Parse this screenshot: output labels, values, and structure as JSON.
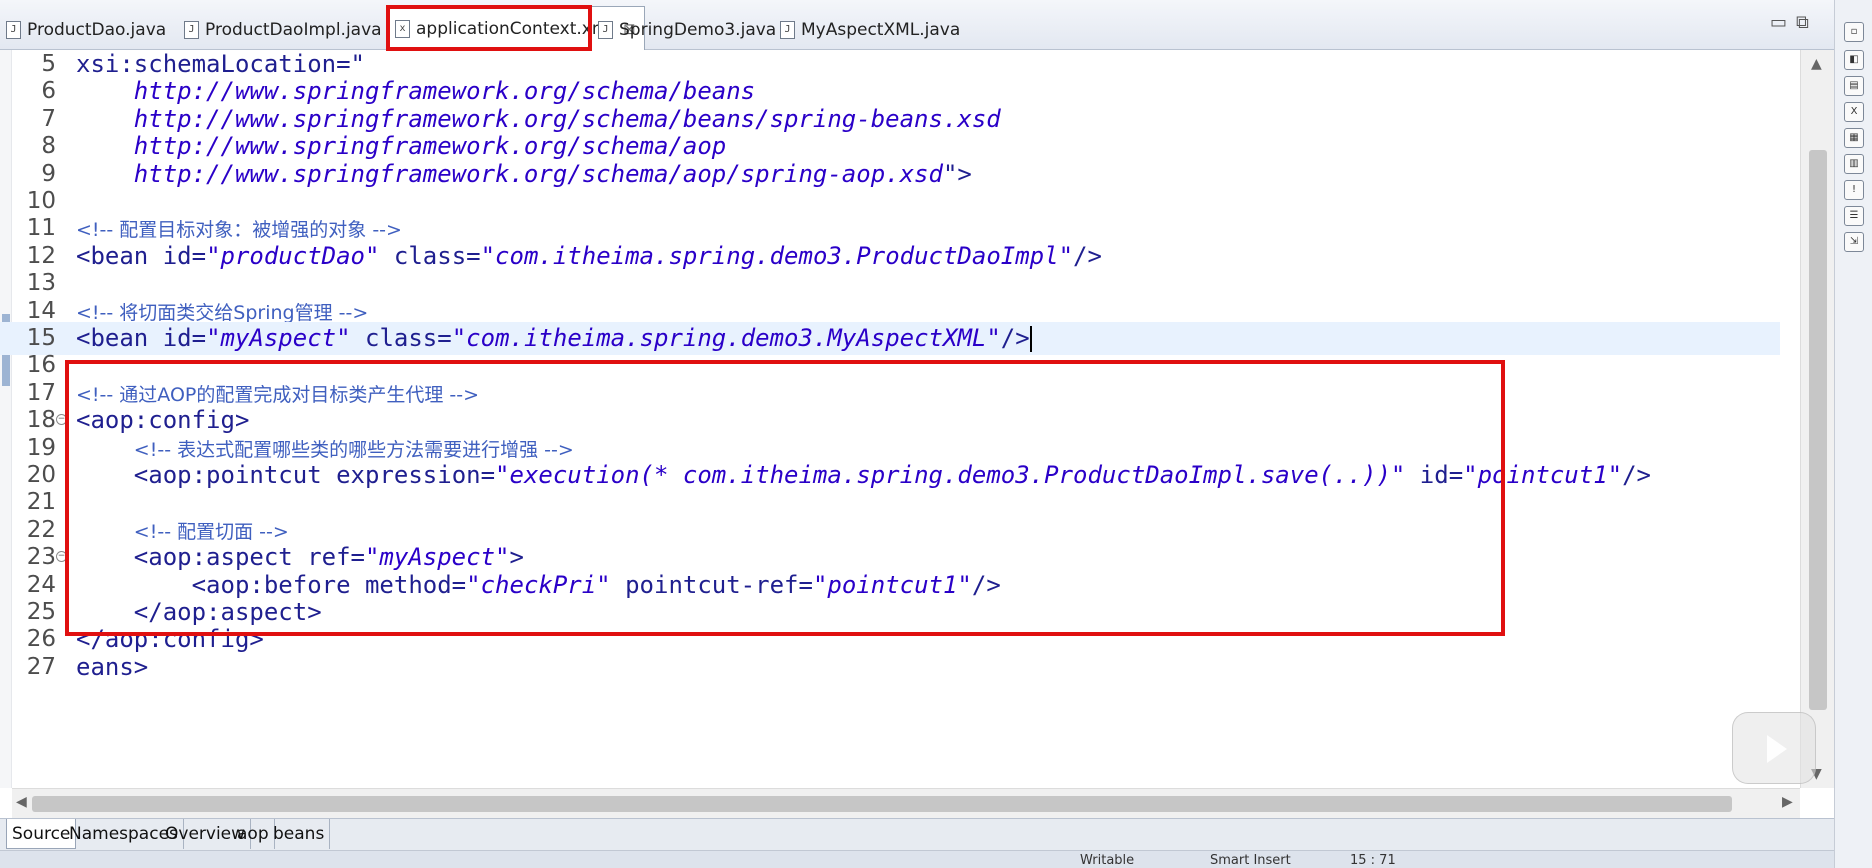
{
  "tabs": [
    {
      "label": "ProductDao.java"
    },
    {
      "label": "ProductDaoImpl.java"
    },
    {
      "label": "applicationContext.xml"
    },
    {
      "label": "SpringDemo3.java"
    },
    {
      "label": "MyAspectXML.java"
    }
  ],
  "editor": {
    "lines": [
      {
        "num": "5",
        "code": [
          {
            "t": "xsi:schemaLocation=\"",
            "c": "attr"
          }
        ]
      },
      {
        "num": "6",
        "code": [
          {
            "t": "    http://www.springframework.org/schema/beans",
            "c": "val"
          }
        ]
      },
      {
        "num": "7",
        "code": [
          {
            "t": "    http://www.springframework.org/schema/beans/spring-beans.xsd",
            "c": "val"
          }
        ]
      },
      {
        "num": "8",
        "code": [
          {
            "t": "    http://www.springframework.org/schema/aop",
            "c": "val"
          }
        ]
      },
      {
        "num": "9",
        "code": [
          {
            "t": "    http://www.springframework.org/schema/aop/spring-aop.xsd",
            "c": "val"
          },
          {
            "t": "\">",
            "c": "tag"
          }
        ]
      },
      {
        "num": "10",
        "code": []
      },
      {
        "num": "11",
        "code": [
          {
            "t": "<!-- 配置目标对象：被增强的对象 -->",
            "c": "cm"
          }
        ]
      },
      {
        "num": "12",
        "code": [
          {
            "t": "<bean ",
            "c": "tag"
          },
          {
            "t": "id=",
            "c": "attr"
          },
          {
            "t": "\"productDao\"",
            "c": "val"
          },
          {
            "t": " class=",
            "c": "attr"
          },
          {
            "t": "\"com.itheima.spring.demo3.ProductDaoImpl\"",
            "c": "val"
          },
          {
            "t": "/>",
            "c": "tag"
          }
        ]
      },
      {
        "num": "13",
        "code": []
      },
      {
        "num": "14",
        "code": [
          {
            "t": "<!-- 将切面类交给Spring管理 -->",
            "c": "cm"
          }
        ]
      },
      {
        "num": "15",
        "code": [
          {
            "t": "<bean ",
            "c": "tag"
          },
          {
            "t": "id=",
            "c": "attr"
          },
          {
            "t": "\"myAspect\"",
            "c": "val"
          },
          {
            "t": " class=",
            "c": "attr"
          },
          {
            "t": "\"com.itheima.spring.demo3.MyAspectXML\"",
            "c": "val"
          },
          {
            "t": "/>",
            "c": "tag"
          }
        ],
        "current": true
      },
      {
        "num": "16",
        "code": []
      },
      {
        "num": "17",
        "code": [
          {
            "t": "<!-- 通过AOP的配置完成对目标类产生代理 -->",
            "c": "cm"
          }
        ]
      },
      {
        "num": "18",
        "code": [
          {
            "t": "<aop:config>",
            "c": "tag"
          }
        ],
        "fold": true
      },
      {
        "num": "19",
        "code": [
          {
            "t": "    ",
            "c": "tag"
          },
          {
            "t": "<!-- 表达式配置哪些类的哪些方法需要进行增强 -->",
            "c": "cm"
          }
        ]
      },
      {
        "num": "20",
        "code": [
          {
            "t": "    <aop:pointcut ",
            "c": "tag"
          },
          {
            "t": "expression=",
            "c": "attr"
          },
          {
            "t": "\"execution(* com.itheima.spring.demo3.ProductDaoImpl.save(..))\"",
            "c": "val"
          },
          {
            "t": " id=",
            "c": "attr"
          },
          {
            "t": "\"pointcut1\"",
            "c": "val"
          },
          {
            "t": "/>",
            "c": "tag"
          }
        ]
      },
      {
        "num": "21",
        "code": []
      },
      {
        "num": "22",
        "code": [
          {
            "t": "    ",
            "c": "tag"
          },
          {
            "t": "<!-- 配置切面 -->",
            "c": "cm"
          }
        ]
      },
      {
        "num": "23",
        "code": [
          {
            "t": "    <aop:aspect ",
            "c": "tag"
          },
          {
            "t": "ref=",
            "c": "attr"
          },
          {
            "t": "\"myAspect\"",
            "c": "val"
          },
          {
            "t": ">",
            "c": "tag"
          }
        ],
        "fold": true
      },
      {
        "num": "24",
        "code": [
          {
            "t": "        <aop:before ",
            "c": "tag"
          },
          {
            "t": "method=",
            "c": "attr"
          },
          {
            "t": "\"checkPri\"",
            "c": "val"
          },
          {
            "t": " pointcut-ref=",
            "c": "attr"
          },
          {
            "t": "\"pointcut1\"",
            "c": "val"
          },
          {
            "t": "/>",
            "c": "tag"
          }
        ]
      },
      {
        "num": "25",
        "code": [
          {
            "t": "    </aop:aspect>",
            "c": "tag"
          }
        ]
      },
      {
        "num": "26",
        "code": [
          {
            "t": "</aop:config>",
            "c": "tag"
          }
        ]
      },
      {
        "num": "27",
        "code": [
          {
            "t": "eans>",
            "c": "tag"
          }
        ]
      }
    ]
  },
  "bottom_tabs": [
    {
      "label": "Source"
    },
    {
      "label": "Namespaces"
    },
    {
      "label": "Overview"
    },
    {
      "label": "aop"
    },
    {
      "label": "beans"
    }
  ],
  "status": {
    "left": "Writable",
    "mid": "Smart Insert",
    "pos": "15 : 71"
  },
  "icons": {
    "file": "file-icon",
    "xml": "xml-file-icon",
    "close": "close-icon",
    "play": "play-icon"
  }
}
